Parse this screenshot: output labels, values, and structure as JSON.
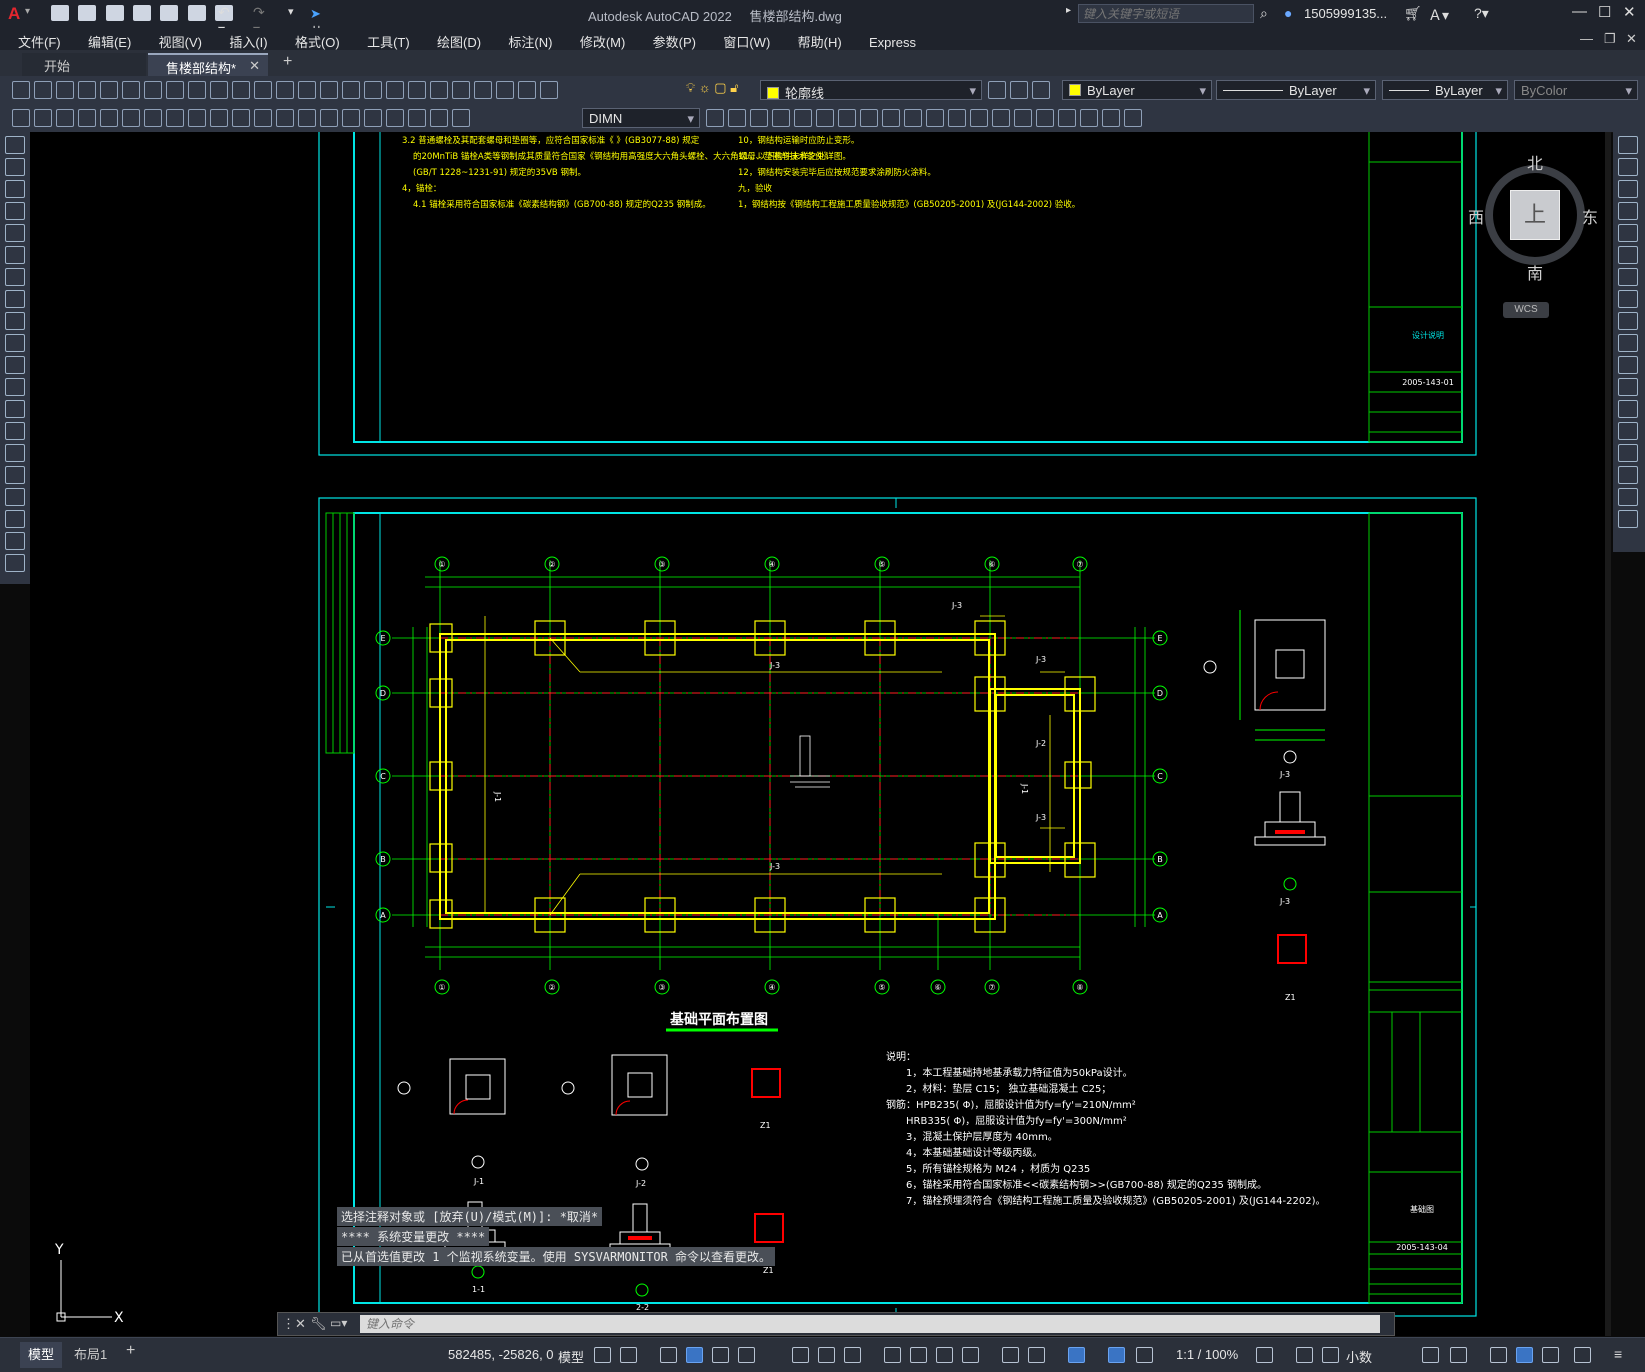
{
  "app": {
    "window_title": "Autodesk AutoCAD 2022",
    "file_name": "售楼部结构.dwg",
    "share_label": "共享",
    "search_placeholder": "键入关键字或短语",
    "user": "1505999135...",
    "logo_letter": "A"
  },
  "menu": [
    "文件(F)",
    "编辑(E)",
    "视图(V)",
    "插入(I)",
    "格式(O)",
    "工具(T)",
    "绘图(D)",
    "标注(N)",
    "修改(M)",
    "参数(P)",
    "窗口(W)",
    "帮助(H)",
    "Express"
  ],
  "tabs": [
    {
      "label": "开始",
      "active": false
    },
    {
      "label": "售楼部结构*",
      "active": true
    }
  ],
  "toolbar": {
    "layer_name": "轮廓线",
    "color": "ByLayer",
    "linetype": "ByLayer",
    "lineweight": "ByLayer",
    "plotstyle": "ByColor",
    "dimstyle": "DIMN"
  },
  "viewcube": {
    "north": "北",
    "south": "南",
    "east": "东",
    "west": "西",
    "face": "上",
    "wcs": "WCS"
  },
  "ucs": {
    "x": "X",
    "y": "Y"
  },
  "drawing": {
    "plan_title": "基础平面布置图",
    "grid_cols": [
      "①",
      "②",
      "③",
      "④",
      "⑤",
      "⑥",
      "⑦"
    ],
    "grid_cols_bottom": [
      "①",
      "②",
      "③",
      "④",
      "⑤",
      "⑥",
      "⑦",
      "⑧"
    ],
    "grid_rows": [
      "E",
      "D",
      "C",
      "B",
      "A"
    ],
    "labels": {
      "j3": "J-3",
      "j2": "J-2",
      "j1": "J-1",
      "ann1": "J-1",
      "ann2": "J-2",
      "sec1": "1-1",
      "sec2": "2-2",
      "sec3": "J-3",
      "z1": "Z1"
    },
    "notes_title": "说明：",
    "notes": [
      "1，本工程基础持地基承载力特征值为50kPa设计。",
      "2，材料：垫层 C15；  独立基础混凝土 C25；",
      "钢筋：HPB235( Φ)，屈服设计值为fy=fy'=210N/mm²",
      "HRB335( Φ)，屈服设计值为fy=fy'=300N/mm²",
      "3，混凝土保护层厚度为     40mm。",
      "4，本基础基础设计等级丙级。",
      "5，所有锚栓规格为      M24 ，材质为   Q235",
      "6，锚栓采用符合国家标准<<碳素结构钢>>(GB700-88) 规定的Q235 钢制成。",
      "7，锚栓预埋须符合《钢结构工程施工质量及验收规范》(GB50205-2001) 及(JG144-2202)。"
    ],
    "top_notes": [
      "3.2 普通螺栓及其配套螺母和垫圈等，应符合国家标准《 》(GB3077-88) 规定",
      "的20MnTiB 锚栓A类等钢制成其质量符合国家《钢结构用高强度大六角头螺栓、大六角螺母、垫圈与技术条件》",
      "(GB/T 1228~1231-91) 规定的35VB 钢制。",
      "4，锚栓：",
      "4.1 锚栓采用符合国家标准《碳素结构钢》(GB700-88) 规定的Q235 钢制成。",
      "10，钢结构运输时应防止变形。",
      "11，以下构件未详之处详图。",
      "12，钢结构安装完毕后应按规范要求涂刷防火涂料。",
      "九，验收",
      "1，钢结构按《钢结构工程施工质量验收规范》(GB50205-2001) 及(JG144-2002) 验收。"
    ],
    "tb_drawing_no_top": "2005-143-01",
    "tb_drawing_no_bottom": "2005-143-04",
    "tb_title_bottom": "基础图",
    "tb_title_top": "设计说明"
  },
  "command": {
    "history": [
      "选择注释对象或 [放弃(U)/模式(M)]: *取消*",
      "**** 系统变量更改 ****",
      "已从首选值更改 1 个监视系统变量。使用 SYSVARMONITOR 命令以查看更改。"
    ],
    "placeholder": "键入命令"
  },
  "status": {
    "layout_tabs": [
      "模型",
      "布局1"
    ],
    "coords": "582485, -25826, 0",
    "space": "模型",
    "scale": "1:1 / 100%",
    "units": "小数"
  },
  "colors": {
    "title_bg": "#1f232c",
    "canvas": "#000000",
    "frame": "#00e5e5",
    "grid_line": "#00ff00",
    "foundation": "#ffff00",
    "axis": "#ff2020",
    "highlight": "#ff0000"
  }
}
